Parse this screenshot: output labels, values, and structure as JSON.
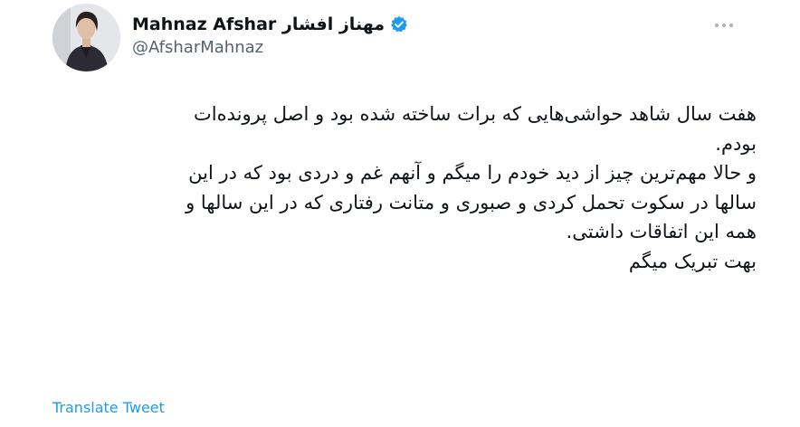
{
  "author": {
    "display_name": "Mahnaz Afshar مهناز افشار",
    "handle": "@AfsharMahnaz"
  },
  "tweet": {
    "lines": [
      "هفت سال شاهد حواشی‌هایی که برات ساخته شده بود و اصل پرونده‌ات",
      "بودم.",
      "و حالا مهم‌ترین چیز از دید خودم را میگم و آنهم غم و دردی بود که در این",
      "سالها در سکوت تحمل کردی و صبوری و متانت رفتاری که در این سالها و",
      "همه این اتفاقات داشتی.",
      "بهت تبریک میگم"
    ]
  },
  "actions": {
    "translate_label": "Translate Tweet"
  },
  "icons": {
    "verified": "verified-badge-icon",
    "more": "more-options-icon"
  },
  "colors": {
    "link": "#1d9bf0",
    "verified": "#1d9bf0",
    "secondary_text": "#536471"
  }
}
